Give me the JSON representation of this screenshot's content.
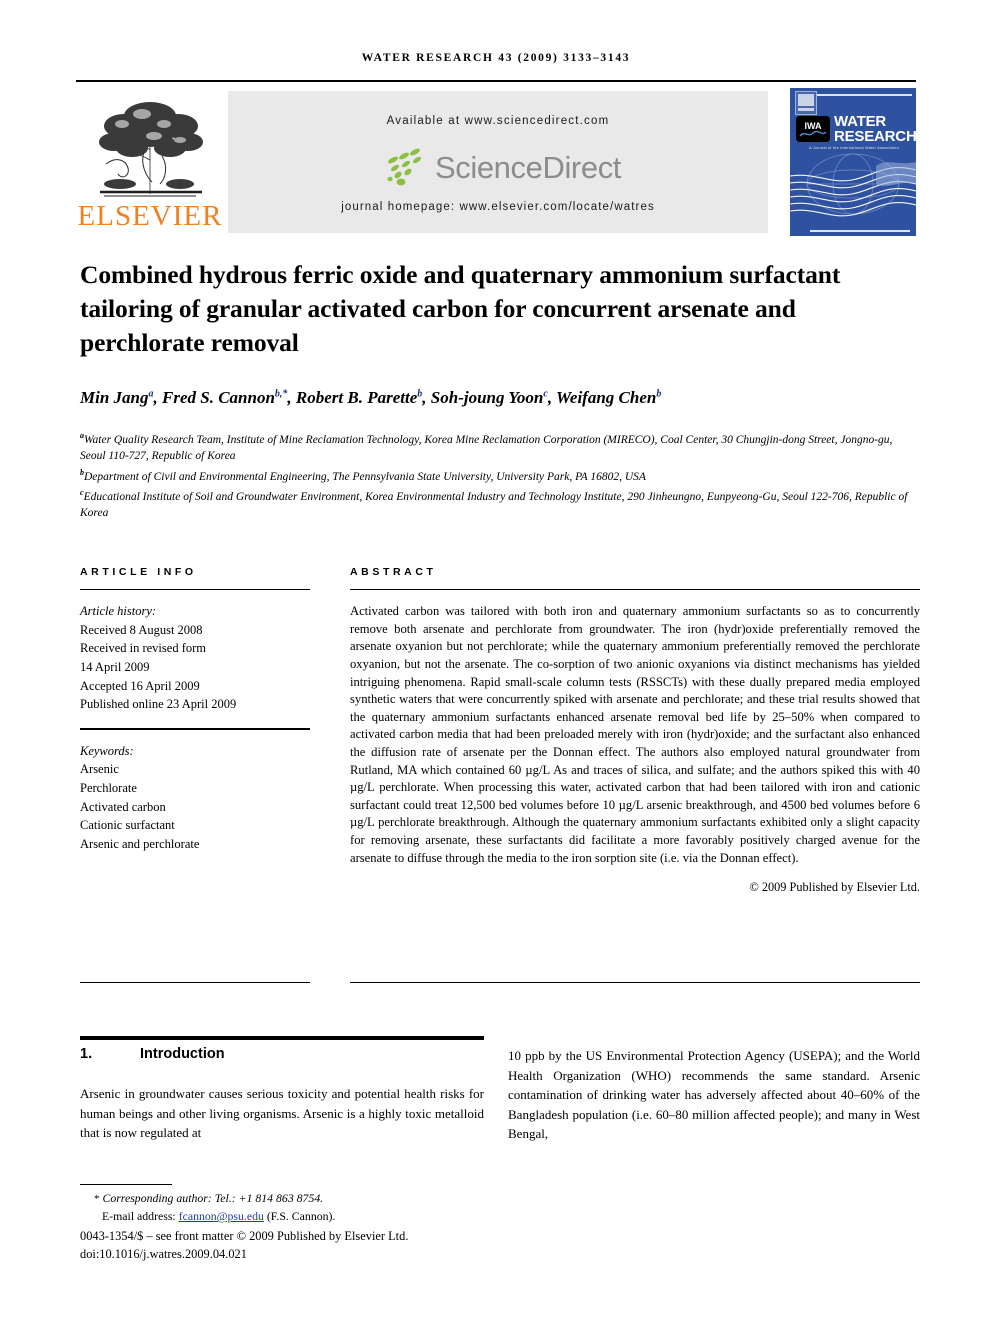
{
  "journal": {
    "running_head": "WATER RESEARCH 43 (2009) 3133–3143",
    "publisher_name": "ELSEVIER",
    "available_at": "Available at www.sciencedirect.com",
    "sciencedirect_word": "ScienceDirect",
    "homepage": "journal homepage: www.elsevier.com/locate/watres",
    "cover": {
      "title_line1": "WATER",
      "title_line2": "RESEARCH",
      "badge": "IWA",
      "tagline": "A Journal of the International Water Association",
      "bg_color": "#2f52a0"
    },
    "accent_orange": "#f08020",
    "link_blue": "#1a3fa0",
    "superscript_blue": "#1d2f7a"
  },
  "article": {
    "title": "Combined hydrous ferric oxide and quaternary ammonium surfactant tailoring of granular activated carbon for concurrent arsenate and perchlorate removal",
    "authors": [
      {
        "name": "Min Jang",
        "marks": "a"
      },
      {
        "name": "Fred S. Cannon",
        "marks": "b,*"
      },
      {
        "name": "Robert B. Parette",
        "marks": "b"
      },
      {
        "name": "Soh-joung Yoon",
        "marks": "c"
      },
      {
        "name": "Weifang Chen",
        "marks": "b"
      }
    ],
    "affiliations": [
      {
        "mark": "a",
        "text": "Water Quality Research Team, Institute of Mine Reclamation Technology, Korea Mine Reclamation Corporation (MIRECO), Coal Center, 30 Chungjin-dong Street, Jongno-gu, Seoul 110-727, Republic of Korea"
      },
      {
        "mark": "b",
        "text": "Department of Civil and Environmental Engineering, The Pennsylvania State University, University Park, PA 16802, USA"
      },
      {
        "mark": "c",
        "text": "Educational Institute of Soil and Groundwater Environment, Korea Environmental Industry and Technology Institute, 290 Jinheungno, Eunpyeong-Gu, Seoul 122-706, Republic of Korea"
      }
    ]
  },
  "article_info": {
    "heading": "ARTICLE INFO",
    "history_label": "Article history:",
    "history": [
      "Received 8 August 2008",
      "Received in revised form",
      "14 April 2009",
      "Accepted 16 April 2009",
      "Published online 23 April 2009"
    ],
    "keywords_label": "Keywords:",
    "keywords": [
      "Arsenic",
      "Perchlorate",
      "Activated carbon",
      "Cationic surfactant",
      "Arsenic and perchlorate"
    ]
  },
  "abstract": {
    "heading": "ABSTRACT",
    "text": "Activated carbon was tailored with both iron and quaternary ammonium surfactants so as to concurrently remove both arsenate and perchlorate from groundwater. The iron (hydr)oxide preferentially removed the arsenate oxyanion but not perchlorate; while the quaternary ammonium preferentially removed the perchlorate oxyanion, but not the arsenate. The co-sorption of two anionic oxyanions via distinct mechanisms has yielded intriguing phenomena. Rapid small-scale column tests (RSSCTs) with these dually prepared media employed synthetic waters that were concurrently spiked with arsenate and perchlorate; and these trial results showed that the quaternary ammonium surfactants enhanced arsenate removal bed life by 25–50% when compared to activated carbon media that had been preloaded merely with iron (hydr)oxide; and the surfactant also enhanced the diffusion rate of arsenate per the Donnan effect. The authors also employed natural groundwater from Rutland, MA which contained 60 µg/L As and traces of silica, and sulfate; and the authors spiked this with 40 µg/L perchlorate. When processing this water, activated carbon that had been tailored with iron and cationic surfactant could treat 12,500 bed volumes before 10 µg/L arsenic breakthrough, and 4500 bed volumes before 6 µg/L perchlorate breakthrough. Although the quaternary ammonium surfactants exhibited only a slight capacity for removing arsenate, these surfactants did facilitate a more favorably positively charged avenue for the arsenate to diffuse through the media to the iron sorption site (i.e. via the Donnan effect).",
    "copyright": "© 2009 Published by Elsevier Ltd."
  },
  "section": {
    "number": "1.",
    "title": "Introduction",
    "column_left": "Arsenic in groundwater causes serious toxicity and potential health risks for human beings and other living organisms. Arsenic is a highly toxic metalloid that is now regulated at",
    "column_right": "10 ppb by the US Environmental Protection Agency (USEPA); and the World Health Organization (WHO) recommends the same standard. Arsenic contamination of drinking water has adversely affected about 40–60% of the Bangladesh population (i.e. 60–80 million affected people); and many in West Bengal,"
  },
  "footer": {
    "corresponding_label": "Corresponding author: Tel.: +1 814 863 8754.",
    "email_label": "E-mail address:",
    "email": "fcannon@psu.edu",
    "email_owner": "(F.S. Cannon).",
    "issn_line": "0043-1354/$ – see front matter © 2009 Published by Elsevier Ltd.",
    "doi_line": "doi:10.1016/j.watres.2009.04.021"
  }
}
